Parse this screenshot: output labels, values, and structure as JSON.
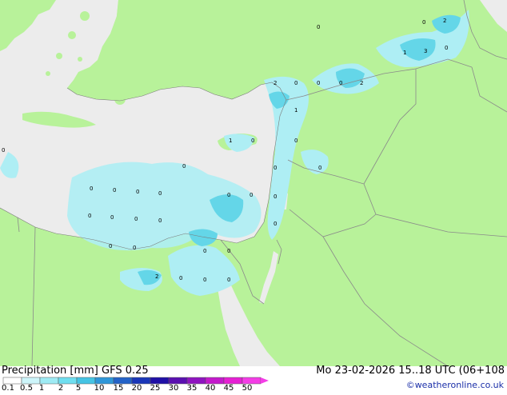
{
  "footer": {
    "title": "Precipitation [mm]  GFS 0.25",
    "timestamp": "Mo 23-02-2026 15..18 UTC (06+108",
    "credit": "©weatheronline.co.uk"
  },
  "legend": {
    "scale_labels": [
      "0.1",
      "0.5",
      "1",
      "2",
      "5",
      "10",
      "15",
      "20",
      "25",
      "30",
      "35",
      "40",
      "45",
      "50"
    ],
    "colors": [
      "#ffffff",
      "#cdf5fa",
      "#9eebf4",
      "#6fdff0",
      "#45c4e4",
      "#2f97d9",
      "#2463c8",
      "#1a36b8",
      "#2010a6",
      "#5a10b0",
      "#8f14c0",
      "#c41acc",
      "#e620d4",
      "#f43de6"
    ]
  },
  "colors": {
    "land": "#b8f29a",
    "sea": "#ececec",
    "border": "#8a8a8a",
    "precip_light": "#aeeef4",
    "precip_medium": "#64d6e8"
  },
  "precip_values": [
    "0",
    "2",
    "0",
    "1",
    "3",
    "0",
    "2",
    "0",
    "0",
    "0",
    "2",
    "1",
    "0",
    "1",
    "0",
    "0",
    "0",
    "0",
    "0",
    "0",
    "0",
    "0",
    "0",
    "0",
    "0",
    "0",
    "0",
    "0",
    "0",
    "0",
    "0",
    "0",
    "0",
    "0",
    "0",
    "0",
    "2",
    "0",
    "0",
    "0",
    "0",
    "0",
    "0"
  ]
}
